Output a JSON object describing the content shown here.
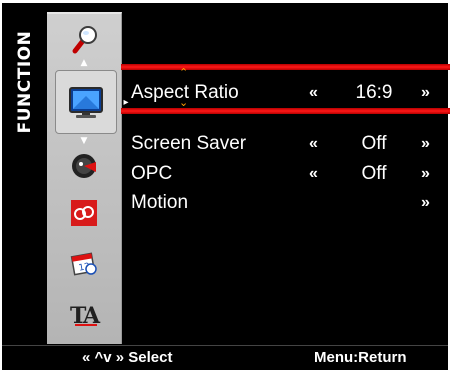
{
  "sidebar": {
    "title": "FUNCTION"
  },
  "menu": {
    "items": [
      {
        "label": "Aspect Ratio",
        "value": "16:9",
        "left_arrow": "«",
        "right_arrow": "»"
      },
      {
        "label": "Screen Saver",
        "value": "Off",
        "left_arrow": "«",
        "right_arrow": "»"
      },
      {
        "label": "OPC",
        "value": "Off",
        "left_arrow": "«",
        "right_arrow": "»"
      },
      {
        "label": "Motion",
        "value": "",
        "left_arrow": "",
        "right_arrow": "»"
      }
    ],
    "up_chevron": "⌃",
    "down_chevron": "⌄"
  },
  "footer": {
    "nav_hint": "« ^v » Select",
    "return_hint": "Menu:Return"
  },
  "colors": {
    "highlight": "#ff1818",
    "accent": "#ff9b00",
    "background": "#000000",
    "icon_column": "#c4c4c4"
  },
  "icons": [
    "search-icon",
    "monitor-icon",
    "picture-settings-icon",
    "link-icon",
    "calendar-icon",
    "ta-icon"
  ]
}
